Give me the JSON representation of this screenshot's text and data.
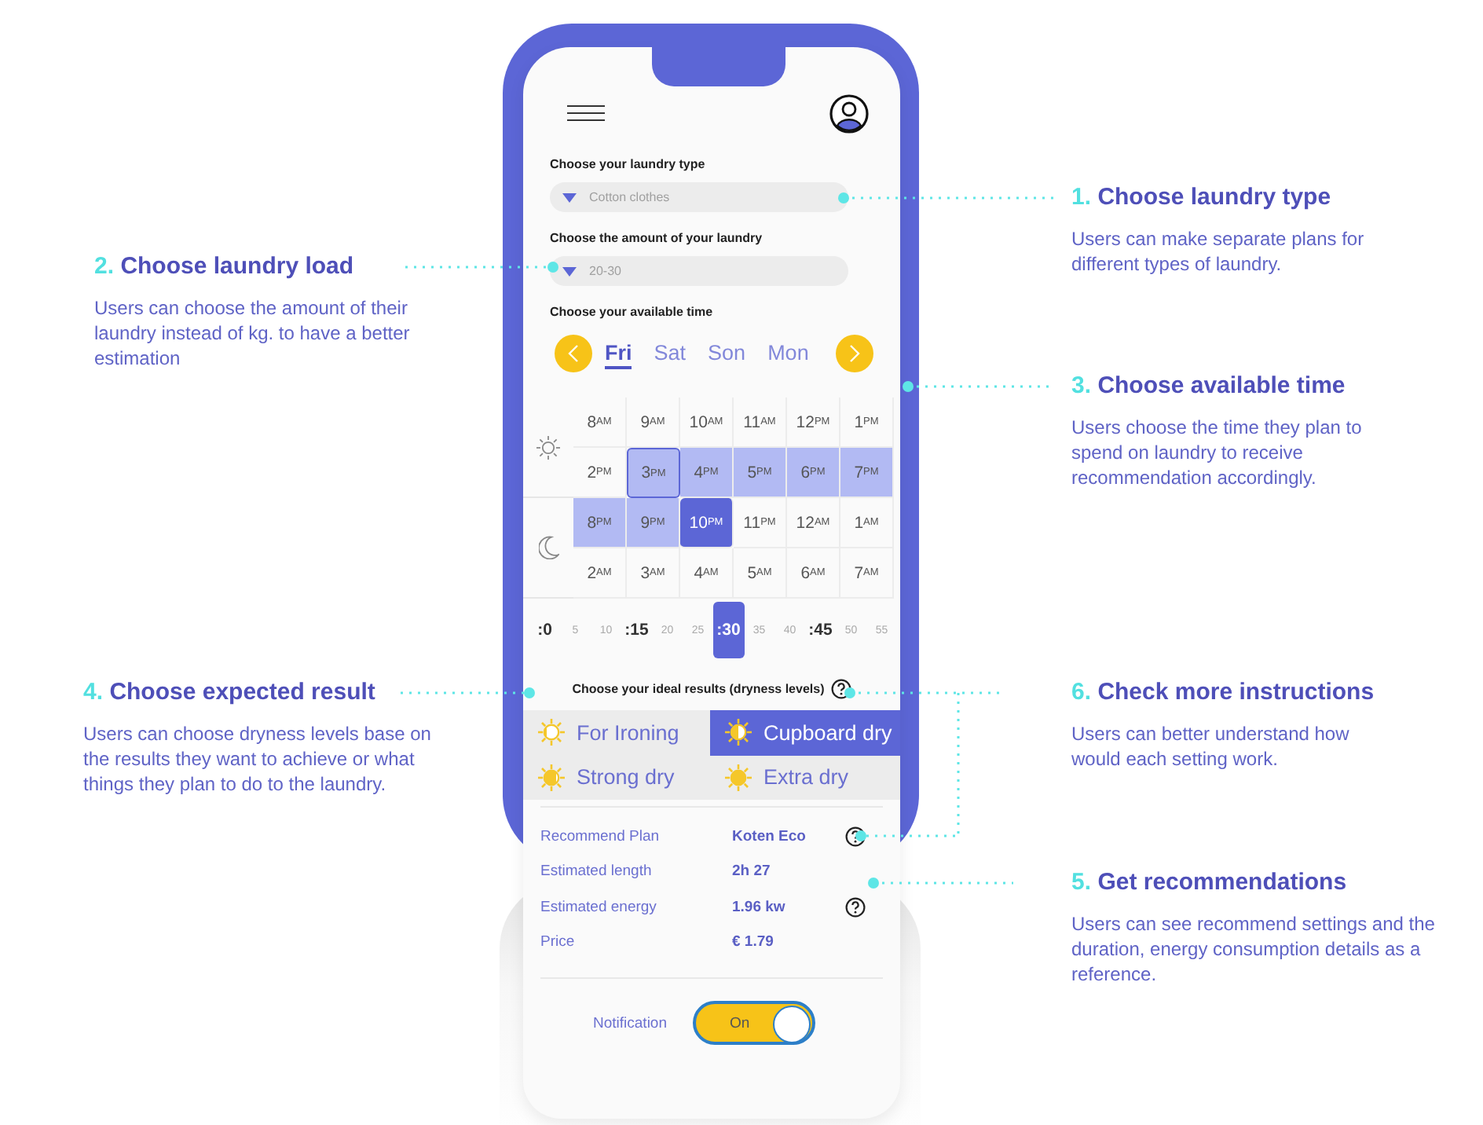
{
  "annotations": [
    {
      "number": "1.",
      "title": "Choose laundry type",
      "text": "Users can make separate plans for different types of laundry."
    },
    {
      "number": "2.",
      "title": "Choose laundry load",
      "text": "Users can choose the amount of their laundry instead of kg. to have a better estimation"
    },
    {
      "number": "3.",
      "title": "Choose available time",
      "text": "Users choose the time they plan to spend on laundry to receive recommendation accordingly."
    },
    {
      "number": "4.",
      "title": "Choose expected result",
      "text": "Users can choose dryness levels base on the results they want to achieve or what things they plan to do to the laundry."
    },
    {
      "number": "6.",
      "title": "Check more instructions",
      "text": "Users can better understand how would each setting work."
    },
    {
      "number": "5.",
      "title": "Get recommendations",
      "text": "Users can see recommend settings and the duration, energy consumption details as a reference."
    }
  ],
  "phone": {
    "laundry_type": {
      "label": "Choose your laundry type",
      "value": "Cotton clothes"
    },
    "laundry_amount": {
      "label": "Choose the amount of your laundry",
      "value": "20-30"
    },
    "available_time": {
      "label": "Choose your available time",
      "days": [
        {
          "label": "Fri",
          "selected": true
        },
        {
          "label": "Sat",
          "selected": false
        },
        {
          "label": "Son",
          "selected": false
        },
        {
          "label": "Mon",
          "selected": false
        }
      ],
      "hour_rows": [
        [
          {
            "hour": "8",
            "period": "AM",
            "in_range": false,
            "outlined": false,
            "selected": false
          },
          {
            "hour": "9",
            "period": "AM",
            "in_range": false,
            "outlined": false,
            "selected": false
          },
          {
            "hour": "10",
            "period": "AM",
            "in_range": false,
            "outlined": false,
            "selected": false
          },
          {
            "hour": "11",
            "period": "AM",
            "in_range": false,
            "outlined": false,
            "selected": false
          },
          {
            "hour": "12",
            "period": "PM",
            "in_range": false,
            "outlined": false,
            "selected": false
          },
          {
            "hour": "1",
            "period": "PM",
            "in_range": false,
            "outlined": false,
            "selected": false
          }
        ],
        [
          {
            "hour": "2",
            "period": "PM",
            "in_range": false,
            "outlined": false,
            "selected": false
          },
          {
            "hour": "3",
            "period": "PM",
            "in_range": true,
            "outlined": true,
            "selected": false
          },
          {
            "hour": "4",
            "period": "PM",
            "in_range": true,
            "outlined": false,
            "selected": false
          },
          {
            "hour": "5",
            "period": "PM",
            "in_range": true,
            "outlined": false,
            "selected": false
          },
          {
            "hour": "6",
            "period": "PM",
            "in_range": true,
            "outlined": false,
            "selected": false
          },
          {
            "hour": "7",
            "period": "PM",
            "in_range": true,
            "outlined": false,
            "selected": false
          }
        ],
        [
          {
            "hour": "8",
            "period": "PM",
            "in_range": true,
            "outlined": false,
            "selected": false
          },
          {
            "hour": "9",
            "period": "PM",
            "in_range": true,
            "outlined": false,
            "selected": false
          },
          {
            "hour": "10",
            "period": "PM",
            "in_range": true,
            "outlined": false,
            "selected": true
          },
          {
            "hour": "11",
            "period": "PM",
            "in_range": false,
            "outlined": false,
            "selected": false
          },
          {
            "hour": "12",
            "period": "AM",
            "in_range": false,
            "outlined": false,
            "selected": false
          },
          {
            "hour": "1",
            "period": "AM",
            "in_range": false,
            "outlined": false,
            "selected": false
          }
        ],
        [
          {
            "hour": "2",
            "period": "AM",
            "in_range": false,
            "outlined": false,
            "selected": false
          },
          {
            "hour": "3",
            "period": "AM",
            "in_range": false,
            "outlined": false,
            "selected": false
          },
          {
            "hour": "4",
            "period": "AM",
            "in_range": false,
            "outlined": false,
            "selected": false
          },
          {
            "hour": "5",
            "period": "AM",
            "in_range": false,
            "outlined": false,
            "selected": false
          },
          {
            "hour": "6",
            "period": "AM",
            "in_range": false,
            "outlined": false,
            "selected": false
          },
          {
            "hour": "7",
            "period": "AM",
            "in_range": false,
            "outlined": false,
            "selected": false
          }
        ]
      ],
      "minutes": [
        {
          "label": ":0",
          "major": true,
          "selected": false
        },
        {
          "label": "5",
          "major": false,
          "selected": false
        },
        {
          "label": "10",
          "major": false,
          "selected": false
        },
        {
          "label": ":15",
          "major": true,
          "selected": false
        },
        {
          "label": "20",
          "major": false,
          "selected": false
        },
        {
          "label": "25",
          "major": false,
          "selected": false
        },
        {
          "label": ":30",
          "major": true,
          "selected": true
        },
        {
          "label": "35",
          "major": false,
          "selected": false
        },
        {
          "label": "40",
          "major": false,
          "selected": false
        },
        {
          "label": ":45",
          "major": true,
          "selected": false
        },
        {
          "label": "50",
          "major": false,
          "selected": false
        },
        {
          "label": "55",
          "major": false,
          "selected": false
        }
      ]
    },
    "results_heading": "Choose your ideal results (dryness levels)",
    "dryness_options": [
      {
        "label": "For Ironing",
        "selected": false
      },
      {
        "label": "Cupboard dry",
        "selected": true
      },
      {
        "label": "Strong dry",
        "selected": false
      },
      {
        "label": "Extra dry",
        "selected": false
      }
    ],
    "plan_rows": [
      {
        "label": "Recommend Plan",
        "value": "Koten Eco",
        "help": true
      },
      {
        "label": "Estimated length",
        "value": "2h 27",
        "help": false
      },
      {
        "label": "Estimated energy",
        "value": "1.96 kw",
        "help": true
      },
      {
        "label": "Price",
        "value": "€ 1.79",
        "help": false
      }
    ],
    "notification": {
      "label": "Notification",
      "on": true,
      "state_text": "On"
    }
  }
}
